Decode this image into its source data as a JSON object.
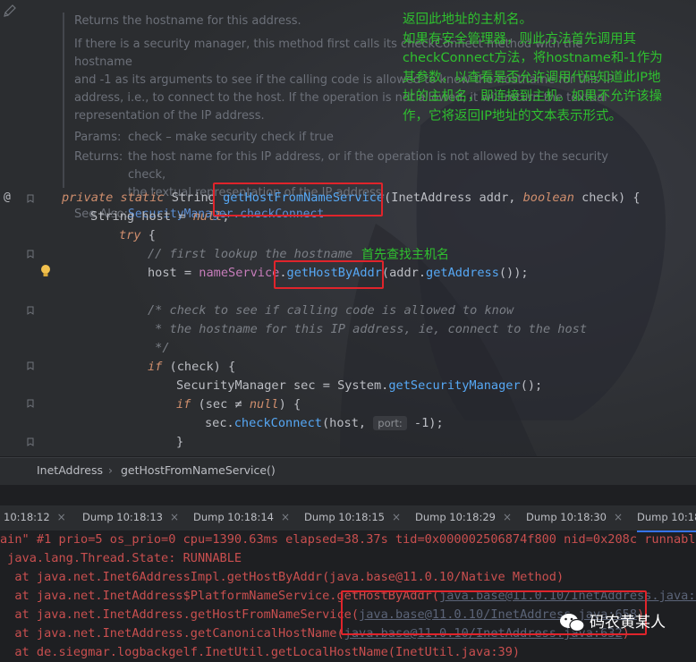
{
  "javadoc": {
    "summary": "Returns the hostname for this address.",
    "description": "If there is a security manager, this method first calls its checkConnect method with the hostname and -1 as its arguments to see if the calling code is allowed to know the hostname for this IP address, i.e., to connect to the host. If the operation is not allowed, it will return the textual representation of the IP address.",
    "desc_lines": [
      "If there is a security manager, this method first calls its checkConnect method with the hostname",
      "and -1 as its arguments to see if the calling code is allowed to know the hostname for this IP",
      "address, i.e., to connect to the host. If the operation is not allowed, it will return the textual",
      "representation of the IP address."
    ],
    "params_label": "Params:",
    "params_text": "check – make security check if true",
    "returns_label": "Returns:",
    "returns_lines": [
      "the host name for this IP address, or if the operation is not allowed by the security check,",
      "the textual representation of the IP address."
    ],
    "see_also_label": "See Also:",
    "see_also_link": "SecurityManager.checkConnect"
  },
  "code": {
    "l1": {
      "mod": "private static ",
      "type": "String ",
      "name": "getHostFromNameService",
      "params_a": "(InetAddress addr, ",
      "kw_bool": "boolean",
      "params_b": " check) {"
    },
    "l2": {
      "type": "String ",
      "rest": "host = ",
      "kw": "null",
      "end": ";"
    },
    "l3": {
      "kw": "try",
      "rest": " {"
    },
    "l4": {
      "comment": "// first lookup the hostname"
    },
    "l5": {
      "a": "host = ",
      "field": "nameService",
      "dot": ".",
      "call": "getHostByAddr",
      "b": "(addr.",
      "call2": "getAddress",
      "c": "());"
    },
    "l6": {
      "comment": "/* check to see if calling code is allowed to know"
    },
    "l7": {
      "comment": " * the hostname for this IP address, ie, connect to the host"
    },
    "l8": {
      "comment": " */"
    },
    "l9": {
      "kw": "if",
      "rest": " (check) {"
    },
    "l10": {
      "type": "SecurityManager ",
      "a": "sec = ",
      "cls": "System",
      "dot": ".",
      "call": "getSecurityManager",
      "b": "();"
    },
    "l11": {
      "kw": "if",
      "a": " (sec ",
      "op": "≠",
      "b": " ",
      "kw2": "null",
      "c": ") {"
    },
    "l12": {
      "a": "sec.",
      "call": "checkConnect",
      "b": "(host, ",
      "hint": "port:",
      "c": " -1);"
    },
    "l13": {
      "a": "}"
    }
  },
  "annotations": {
    "doc_translation_lines": [
      "返回此地址的主机名。",
      "如果有安全管理器，则此方法首先调用其",
      "checkConnect方法，将hostname和-1作为",
      "其参数，以查看是否允许调用代码知道此IP地",
      "址的主机名，即连接到主机。如果不允许该操",
      "作，它将返回IP地址的文本表示形式。"
    ],
    "lookup_note": "首先查找主机名"
  },
  "gutter": {
    "override_marker": "@"
  },
  "breadcrumbs": {
    "class_name": "InetAddress",
    "separator": "›",
    "method_name": "getHostFromNameService()"
  },
  "dump_tabs": [
    {
      "label": "10:18:12",
      "close": "×"
    },
    {
      "label": "Dump 10:18:13",
      "close": "×"
    },
    {
      "label": "Dump 10:18:14",
      "close": "×"
    },
    {
      "label": "Dump 10:18:15",
      "close": "×"
    },
    {
      "label": "Dump 10:18:29",
      "close": "×"
    },
    {
      "label": "Dump 10:18:30",
      "close": "×"
    },
    {
      "label": "Dump 10:18:",
      "close": ""
    }
  ],
  "console": {
    "l1": "ain\" #1 prio=5 os_prio=0 cpu=1390.63ms elapsed=38.37s tid=0x000002506874f800 nid=0x208c runnable",
    "l2": " java.lang.Thread.State: RUNNABLE",
    "l3": "  at java.net.Inet6AddressImpl.getHostByAddr(java.base@11.0.10/Native Method)",
    "l4a": "  at java.net.InetAddress$PlatformNameService.getHostByAddr(",
    "l4link": "java.base@11.0.10/InetAddress.java:935",
    "l4b": ")",
    "l5a": "  at java.net.InetAddress.getHostFromNameService(",
    "l5link": "java.base@11.0.10/InetAddress.java:658",
    "l5b": ")",
    "l6a": "  at java.net.InetAddress.getCanonicalHostName(",
    "l6link": "java.base@11.0.10/InetAddress.java:632",
    "l6b": ")",
    "l7": "  at de.siegmar.logbackgelf.InetUtil.getLocalHostName(InetUtil.java:39)"
  },
  "watermark": {
    "text": "码农黄某人"
  },
  "colors": {
    "highlight_box": "#e0242b",
    "annotation_green": "#2fc02f",
    "keyword": "#cf8e6d",
    "method": "#56a8f5",
    "console_text": "#c94f4f"
  }
}
